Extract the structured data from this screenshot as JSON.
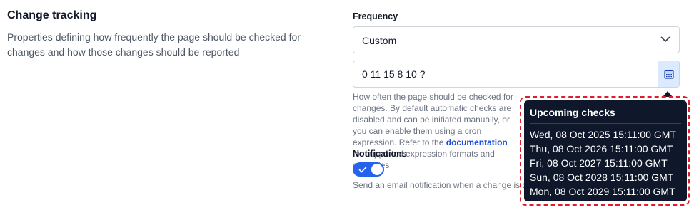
{
  "section": {
    "title": "Change tracking",
    "description": "Properties defining how frequently the page should be checked for changes and how those changes should be reported"
  },
  "frequency": {
    "label": "Frequency",
    "selected": "Custom",
    "cron_value": "0 11 15 8 10 ?",
    "help_prefix": "How often the page should be checked for changes. By default automatic checks are disabled and can be initiated manually, or you can enable them using a cron expression. Refer to the ",
    "help_link": "documentation",
    "help_suffix": " for supported expression formats and examples"
  },
  "notifications": {
    "label": "Notifications",
    "enabled": true,
    "help": "Send an email notification when a change is detected"
  },
  "tooltip": {
    "title": "Upcoming checks",
    "items": [
      "Wed, 08 Oct 2025 15:11:00 GMT",
      "Thu, 08 Oct 2026 15:11:00 GMT",
      "Fri, 08 Oct 2027 15:11:00 GMT",
      "Sun, 08 Oct 2028 15:11:00 GMT",
      "Mon, 08 Oct 2029 15:11:00 GMT"
    ]
  },
  "colors": {
    "accent": "#2563eb",
    "tooltip_bg": "#0f172a",
    "highlight": "#e11d2a"
  },
  "icons": [
    "chevron-down-icon",
    "calendar-icon",
    "check-icon"
  ]
}
